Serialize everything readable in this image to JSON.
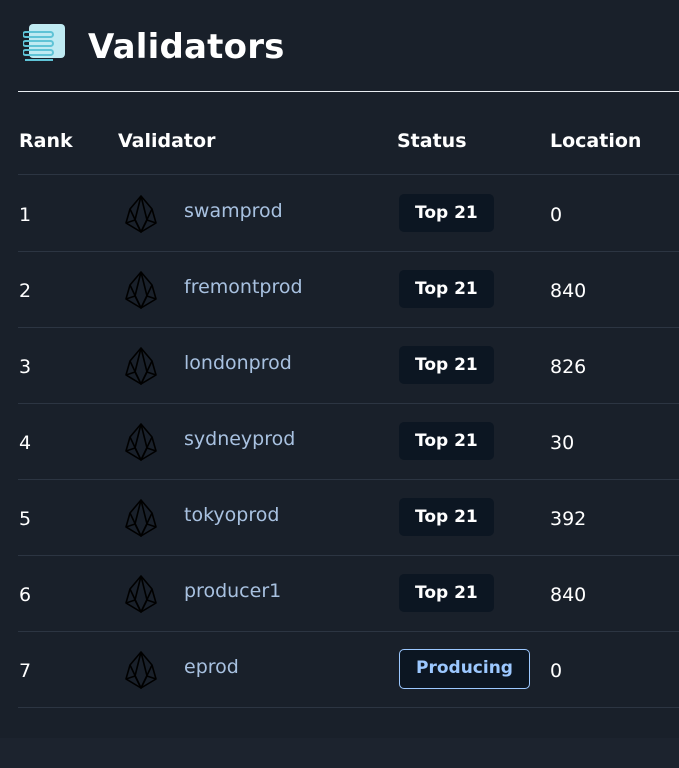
{
  "header": {
    "title": "Validators",
    "icon": "server-list-icon"
  },
  "table": {
    "columns": {
      "rank": "Rank",
      "validator": "Validator",
      "status": "Status",
      "location": "Location"
    },
    "rows": [
      {
        "rank": "1",
        "name": "swamprod",
        "status": "Top 21",
        "location": "0"
      },
      {
        "rank": "2",
        "name": "fremontprod",
        "status": "Top 21",
        "location": "840"
      },
      {
        "rank": "3",
        "name": "londonprod",
        "status": "Top 21",
        "location": "826"
      },
      {
        "rank": "4",
        "name": "sydneyprod",
        "status": "Top 21",
        "location": "30"
      },
      {
        "rank": "5",
        "name": "tokyoprod",
        "status": "Top 21",
        "location": "392"
      },
      {
        "rank": "6",
        "name": "producer1",
        "status": "Top 21",
        "location": "840"
      },
      {
        "rank": "7",
        "name": "eprod",
        "status": "Producing",
        "location": "0"
      }
    ]
  },
  "colors": {
    "background": "#19202a",
    "validator_link": "#a8c1e0",
    "badge_bg": "#0c1622",
    "producing_accent": "#9cc8ff",
    "icon_accent": "#7fd6e6"
  }
}
